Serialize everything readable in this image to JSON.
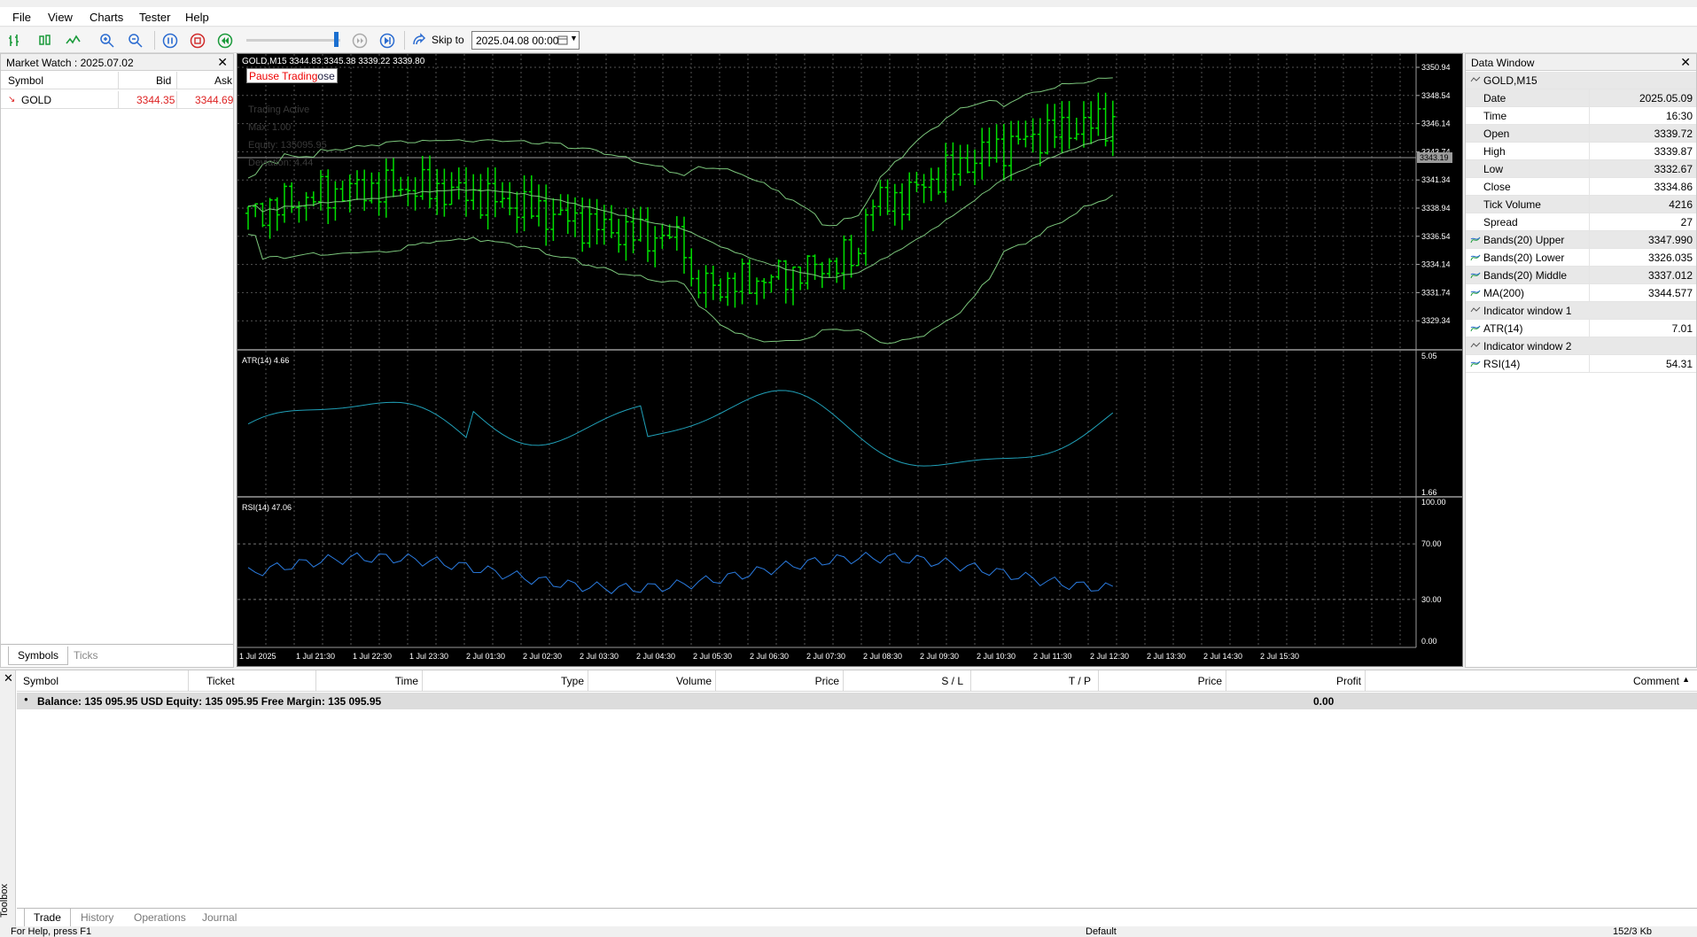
{
  "menu": [
    "File",
    "View",
    "Charts",
    "Tester",
    "Help"
  ],
  "toolbar": {
    "skip_label": "Skip to",
    "skip_value": "2025.04.08 00:00"
  },
  "market_watch": {
    "title": "Market Watch : 2025.07.02",
    "columns": [
      "Symbol",
      "Bid",
      "Ask"
    ],
    "rows": [
      {
        "symbol": "GOLD",
        "bid": "3344.35",
        "ask": "3344.69",
        "direction": "down"
      }
    ],
    "tabs": [
      "Symbols",
      "Ticks"
    ]
  },
  "chart": {
    "header": "GOLD,M15  3344.83 3345.38 3339.22 3339.80",
    "pause_button": "Pause Trading",
    "pause_button_tail": "ose",
    "overlay_lines": [
      "Trading Active",
      "Max: 1.00",
      "Equity: 135095.95",
      "Deviation: 4.44"
    ],
    "price_labels": [
      "3350.94",
      "3348.54",
      "3346.14",
      "3343.74",
      "3341.34",
      "3338.94",
      "3336.54",
      "3334.14",
      "3331.74",
      "3329.34"
    ],
    "current_price": "3343.19",
    "atr_label": "ATR(14) 4.66",
    "atr_scale": [
      "5.05",
      "1.66"
    ],
    "rsi_label": "RSI(14) 47.06",
    "rsi_scale": [
      "100.00",
      "70.00",
      "30.00",
      "0.00"
    ],
    "time_labels": [
      "1 Jul 2025",
      "1 Jul 21:30",
      "1 Jul 22:30",
      "1 Jul 23:30",
      "2 Jul 01:30",
      "2 Jul 02:30",
      "2 Jul 03:30",
      "2 Jul 04:30",
      "2 Jul 05:30",
      "2 Jul 06:30",
      "2 Jul 07:30",
      "2 Jul 08:30",
      "2 Jul 09:30",
      "2 Jul 10:30",
      "2 Jul 11:30",
      "2 Jul 12:30",
      "2 Jul 13:30",
      "2 Jul 14:30",
      "2 Jul 15:30"
    ],
    "colors": {
      "bars": "#00e000",
      "bands": "#7cc77c",
      "atr": "#20a0b8",
      "rsi": "#2a7be0",
      "grid": "#555555"
    }
  },
  "data_window": {
    "title": "Data Window",
    "rows": [
      {
        "label": "GOLD,M15",
        "value": "",
        "kind": "section"
      },
      {
        "label": "Date",
        "value": "2025.05.09",
        "kind": "shade"
      },
      {
        "label": "Time",
        "value": "16:30",
        "kind": "plain"
      },
      {
        "label": "Open",
        "value": "3339.72",
        "kind": "shade"
      },
      {
        "label": "High",
        "value": "3339.87",
        "kind": "plain"
      },
      {
        "label": "Low",
        "value": "3332.67",
        "kind": "shade"
      },
      {
        "label": "Close",
        "value": "3334.86",
        "kind": "plain"
      },
      {
        "label": "Tick Volume",
        "value": "4216",
        "kind": "shade"
      },
      {
        "label": "Spread",
        "value": "27",
        "kind": "plain"
      },
      {
        "label": "Bands(20) Upper",
        "value": "3347.990",
        "kind": "ind-shade"
      },
      {
        "label": "Bands(20) Lower",
        "value": "3326.035",
        "kind": "ind"
      },
      {
        "label": "Bands(20) Middle",
        "value": "3337.012",
        "kind": "ind-shade"
      },
      {
        "label": "MA(200)",
        "value": "3344.577",
        "kind": "ind"
      },
      {
        "label": "Indicator window 1",
        "value": "",
        "kind": "section"
      },
      {
        "label": "ATR(14)",
        "value": "7.01",
        "kind": "ind"
      },
      {
        "label": "Indicator window 2",
        "value": "",
        "kind": "section"
      },
      {
        "label": "RSI(14)",
        "value": "54.31",
        "kind": "ind"
      }
    ]
  },
  "toolbox": {
    "side_label": "Toolbox",
    "columns": [
      "Symbol",
      "Ticket",
      "Time",
      "Type",
      "Volume",
      "Price",
      "S / L",
      "T / P",
      "Price",
      "Profit",
      "Comment"
    ],
    "balance_text": "Balance: 135 095.95 USD  Equity: 135 095.95  Free Margin: 135 095.95",
    "balance_profit": "0.00",
    "tabs": [
      "Trade",
      "History",
      "Operations",
      "Journal"
    ]
  },
  "statusbar": {
    "left": "For Help, press F1",
    "mid": "Default",
    "right": "152/3 Kb"
  }
}
